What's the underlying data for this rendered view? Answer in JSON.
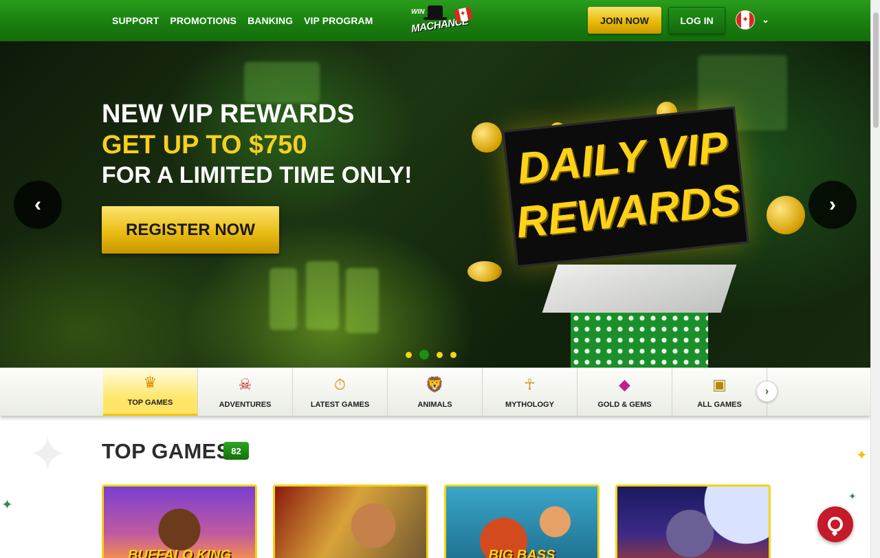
{
  "header": {
    "nav": [
      "SUPPORT",
      "PROMOTIONS",
      "BANKING",
      "VIP PROGRAM"
    ],
    "logo_text_top": "WIN",
    "logo_text_bottom": "MACHANCE",
    "join_label": "JOIN NOW",
    "login_label": "LOG IN",
    "language_icon": "canada-flag-icon"
  },
  "hero": {
    "line1": "NEW VIP REWARDS",
    "line2": "GET UP TO $750",
    "line3": "FOR A LIMITED TIME ONLY!",
    "cta_label": "REGISTER NOW",
    "promo_line1": "DAILY VIP",
    "promo_line2": "REWARDS",
    "prev_icon": "‹",
    "next_icon": "›",
    "slide_count": 4,
    "active_slide": 2
  },
  "categories": [
    {
      "label": "TOP GAMES",
      "icon": "crown-icon",
      "glyph": "♛",
      "color": "#e08a00",
      "active": true
    },
    {
      "label": "ADVENTURES",
      "icon": "pirate-skull-icon",
      "glyph": "☠",
      "color": "#c02020",
      "active": false
    },
    {
      "label": "LATEST GAMES",
      "icon": "stopwatch-icon",
      "glyph": "⏱",
      "color": "#d98a10",
      "active": false
    },
    {
      "label": "ANIMALS",
      "icon": "lion-icon",
      "glyph": "🦁",
      "color": "#d07a1a",
      "active": false
    },
    {
      "label": "MYTHOLOGY",
      "icon": "pharaoh-icon",
      "glyph": "☥",
      "color": "#c89a20",
      "active": false
    },
    {
      "label": "GOLD & GEMS",
      "icon": "gems-icon",
      "glyph": "◆",
      "color": "#c0208a",
      "active": false
    },
    {
      "label": "ALL GAMES",
      "icon": "treasure-chest-icon",
      "glyph": "▣",
      "color": "#b8860b",
      "active": false
    }
  ],
  "section": {
    "title": "TOP GAMES",
    "count": "82"
  },
  "games": [
    {
      "name": "BUFFALO KING"
    },
    {
      "name": ""
    },
    {
      "name": "BIG BASS"
    },
    {
      "name": ""
    }
  ],
  "colors": {
    "brand_green": "#1a7f10",
    "gold": "#f6cf1f",
    "chat_red": "#c41a2a"
  }
}
